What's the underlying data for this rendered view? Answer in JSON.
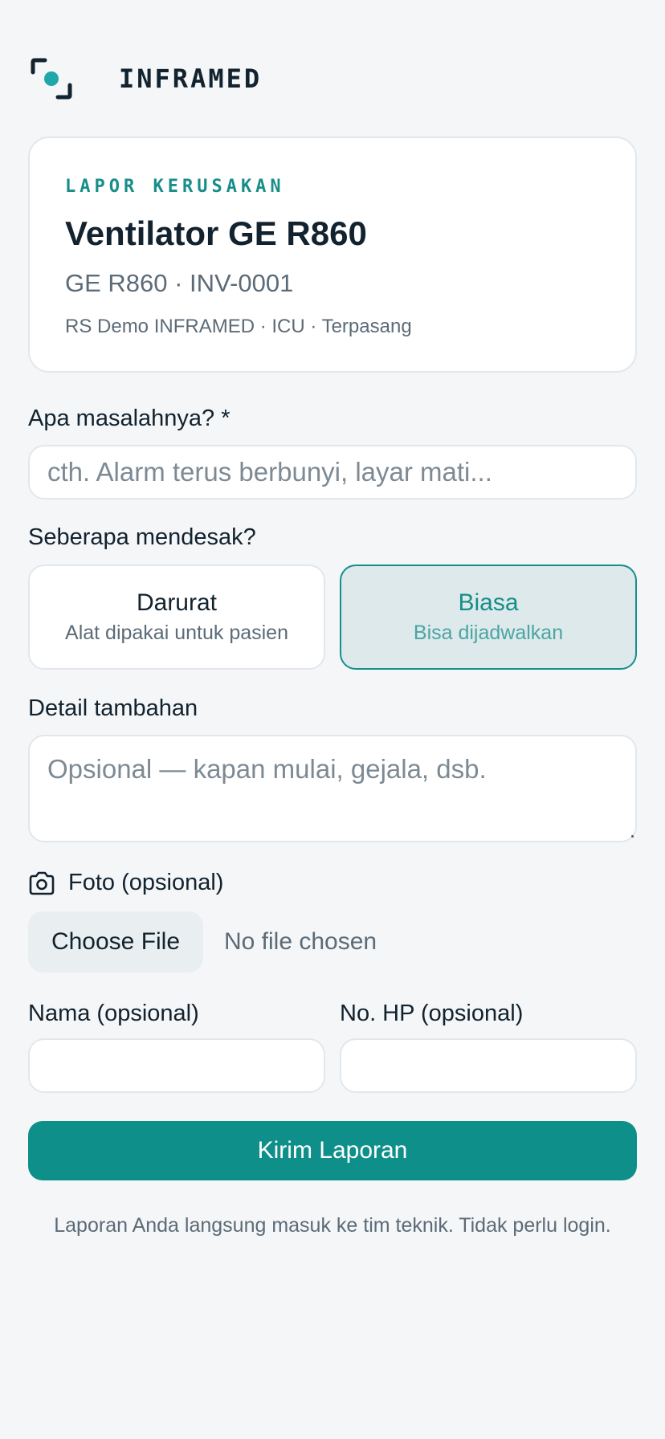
{
  "brand": {
    "name": "INFRAMED",
    "logo_icon": "viewfinder-dot-icon",
    "accent": "#178e8a"
  },
  "device": {
    "eyebrow": "LAPOR KERUSAKAN",
    "title": "Ventilator GE R860",
    "code_line": "GE R860 · INV-0001",
    "location_line": "RS Demo INFRAMED · ICU · Terpasang"
  },
  "form": {
    "problem": {
      "label": "Apa masalahnya? *",
      "placeholder": "cth. Alarm terus berbunyi, layar mati..."
    },
    "urgency": {
      "label": "Seberapa mendesak?",
      "options": [
        {
          "title": "Darurat",
          "subtitle": "Alat dipakai untuk pasien",
          "selected": false
        },
        {
          "title": "Biasa",
          "subtitle": "Bisa dijadwalkan",
          "selected": true
        }
      ]
    },
    "details": {
      "label": "Detail tambahan",
      "placeholder": "Opsional — kapan mulai, gejala, dsb."
    },
    "photo": {
      "label": "Foto (opsional)",
      "icon": "camera-icon",
      "button": "Choose File",
      "status": "No file chosen"
    },
    "name": {
      "label": "Nama (opsional)",
      "value": ""
    },
    "phone": {
      "label": "No. HP (opsional)",
      "value": ""
    },
    "submit_label": "Kirim Laporan",
    "footnote": "Laporan Anda langsung masuk ke tim teknik. Tidak perlu login."
  },
  "colors": {
    "primary": "#0f8f8a",
    "selected_bg": "#dde9ea",
    "background": "#f4f6f8"
  }
}
